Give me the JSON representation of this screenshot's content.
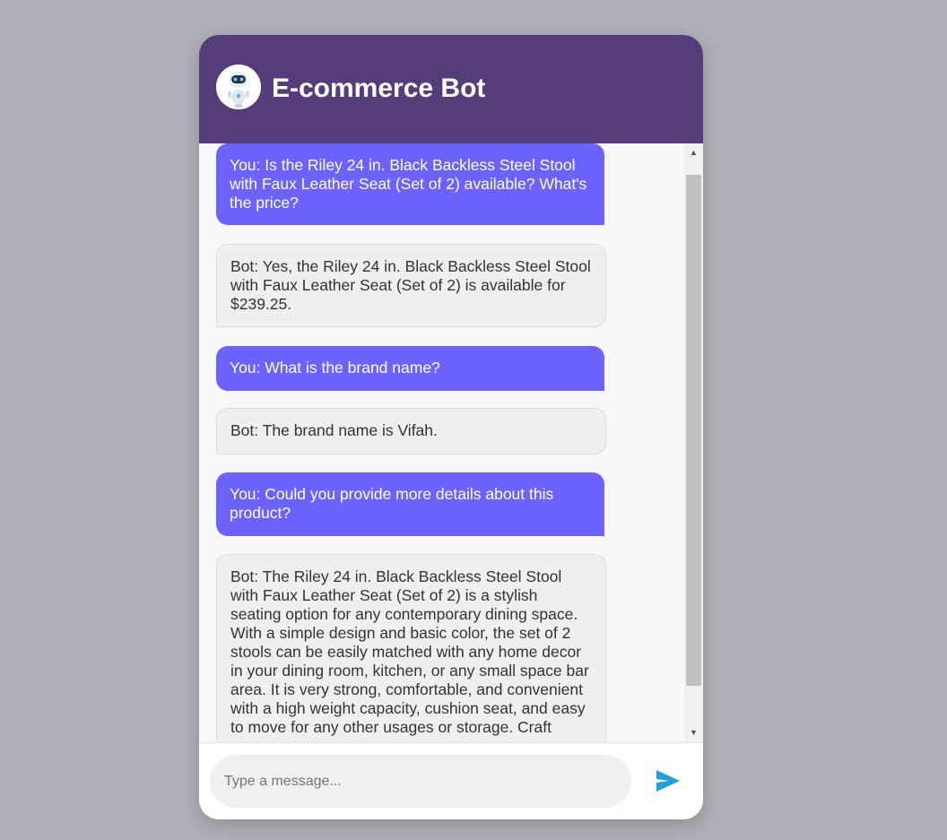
{
  "header": {
    "title": "E-commerce Bot",
    "avatar_icon": "robot-icon"
  },
  "messages": [
    {
      "sender": "user",
      "text": "You: Is the Riley 24 in. Black Backless Steel Stool with Faux Leather Seat (Set of 2) available? What's the price?"
    },
    {
      "sender": "bot",
      "text": "Bot: Yes, the Riley 24 in. Black Backless Steel Stool with Faux Leather Seat (Set of 2) is available for $239.25."
    },
    {
      "sender": "user",
      "text": "You: What is the brand name?"
    },
    {
      "sender": "bot",
      "text": "Bot: The brand name is Vifah."
    },
    {
      "sender": "user",
      "text": "You: Could you provide more details about this product?"
    },
    {
      "sender": "bot",
      "text": "Bot: The Riley 24 in. Black Backless Steel Stool with Faux Leather Seat (Set of 2) is a stylish seating option for any contemporary dining space. With a simple design and basic color, the set of 2 stools can be easily matched with any home decor in your dining room, kitchen, or any small space bar area. It is very strong, comfortable, and convenient with a high weight capacity, cushion seat, and easy to move for any other usages or storage. Craft"
    }
  ],
  "input": {
    "placeholder": "Type a message...",
    "value": ""
  },
  "send_icon": "send-icon",
  "colors": {
    "header": "#553d7b",
    "user_bubble": "#6c63ff",
    "bot_bubble": "#efefef",
    "send": "#1ea0d8",
    "background": "#aeaeb6"
  }
}
